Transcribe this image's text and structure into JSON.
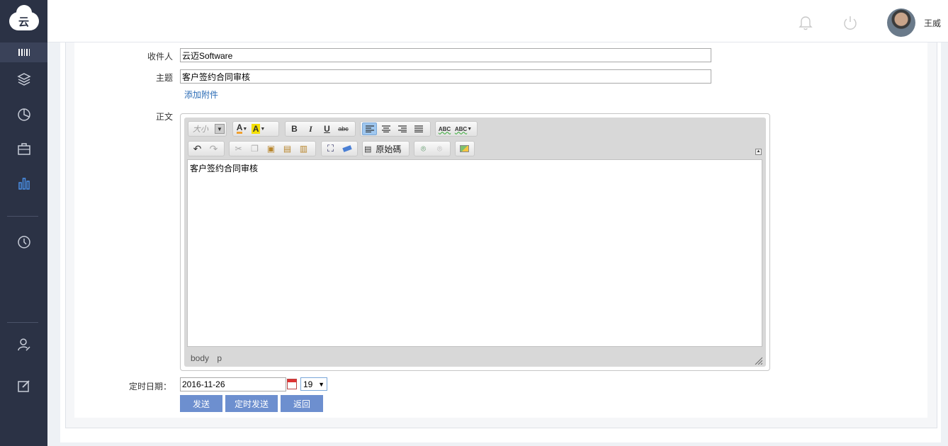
{
  "sidebar": {
    "logo_text": "云",
    "items": [
      {
        "icon": "layers-icon"
      },
      {
        "icon": "pie-chart-icon"
      },
      {
        "icon": "briefcase-icon"
      },
      {
        "icon": "bar-chart-icon",
        "active": true
      },
      {
        "icon": "clock-icon"
      },
      {
        "icon": "user-edit-icon"
      },
      {
        "icon": "edit-icon"
      }
    ],
    "colors": {
      "background": "#2b3245",
      "active": "#4a8fe7"
    }
  },
  "header": {
    "username": "王威",
    "icons": [
      "bell-icon",
      "power-icon"
    ]
  },
  "form": {
    "recipient_label": "收件人",
    "recipient_value": "云迈Software",
    "subject_label": "主题",
    "subject_value": "客户签约合同审核",
    "attach_link": "添加附件",
    "body_label": "正文",
    "editor": {
      "font_size_placeholder": "大小",
      "source_label": "原始碼",
      "content": "客户签约合同审核",
      "status_path": [
        "body",
        "p"
      ]
    },
    "date_label": "定时日期：",
    "date_value": "2016-11-26",
    "hour_value": "19",
    "buttons": {
      "send": "发送",
      "scheduled_send": "定时发送",
      "back": "返回"
    }
  }
}
